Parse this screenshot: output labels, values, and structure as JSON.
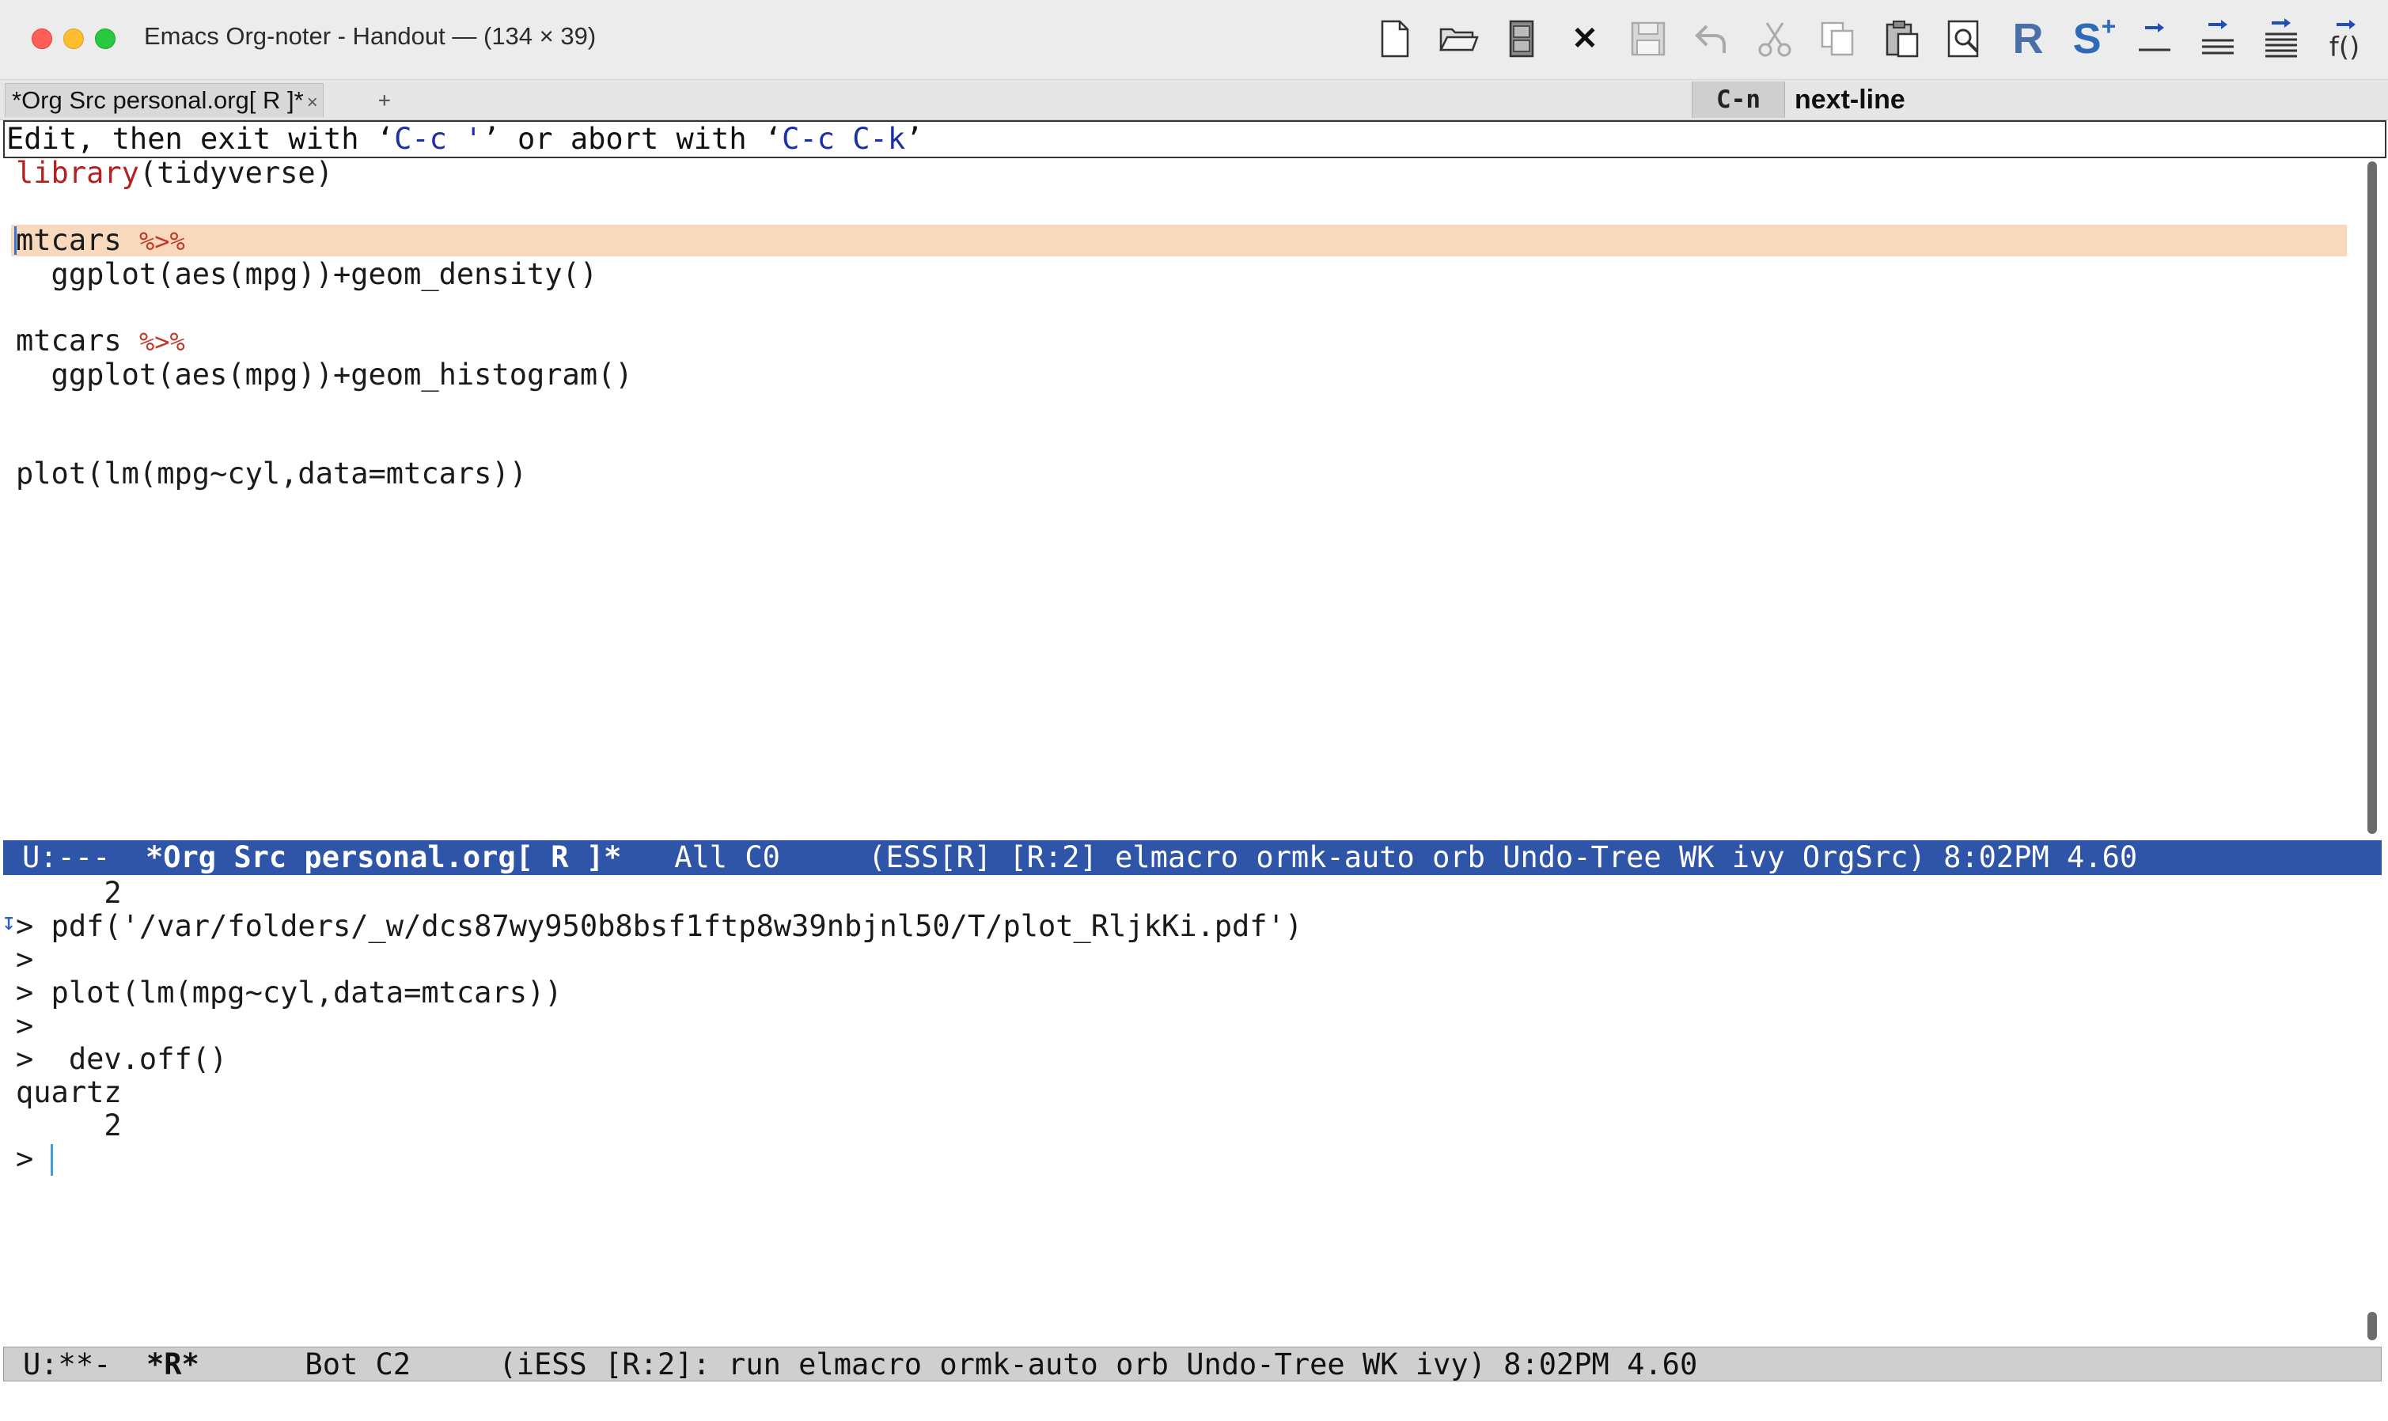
{
  "window": {
    "title": "Emacs Org-noter - Handout — (134 × 39)"
  },
  "toolbar": {
    "icons": [
      "new-file-icon",
      "open-folder-icon",
      "save-cabinet-icon",
      "close-icon",
      "save-disk-icon",
      "undo-icon",
      "cut-icon",
      "copy-icon",
      "paste-icon",
      "search-icon",
      "r-icon",
      "s-plus-icon",
      "eval-line-icon",
      "eval-region-icon",
      "eval-buffer-icon",
      "eval-function-icon"
    ],
    "r_label": "R",
    "s_label": "S",
    "s_plus": "+",
    "f_label": "f()",
    "close_glyph": "✕"
  },
  "tabbar": {
    "tab_label": "*Org Src personal.org[ R ]*",
    "tab_close": "×",
    "new_tab": "+"
  },
  "keyhint": {
    "key": "C-n",
    "command": "next-line"
  },
  "header_line": {
    "p1": "Edit, then exit with ‘",
    "k1": "C-c '",
    "p2": "’ or abort with ‘",
    "k2": "C-c C-k",
    "p3": "’"
  },
  "editor": {
    "l1_fn": "library",
    "l1_rest": "(tidyverse)",
    "l3_obj": "mtcars",
    "l3_op": "%>%",
    "l4": "  ggplot(aes(mpg))+geom_density()",
    "l6_obj": "mtcars",
    "l6_op": "%>%",
    "l7": "  ggplot(aes(mpg))+geom_histogram()",
    "l10": "plot(lm(mpg~cyl,data=mtcars))"
  },
  "modeline_top": {
    "state": "U:---  ",
    "buffer": "*Org Src personal.org[ R ]*",
    "info": "   All C0     (ESS[R] [R:2] elmacro ormk-auto orb Undo-Tree WK ivy OrgSrc) 8:02PM 4.60"
  },
  "repl": {
    "lines": [
      "     2",
      "> pdf('/var/folders/_w/dcs87wy950b8bsf1ftp8w39nbjnl50/T/plot_RljkKi.pdf')",
      ">",
      "> plot(lm(mpg~cyl,data=mtcars))",
      ">",
      ">  dev.off()",
      "quartz",
      "     2",
      "> "
    ]
  },
  "modeline_bottom": {
    "state": "U:**-  ",
    "buffer": "*R*",
    "info": "      Bot C2     (iESS [R:2]: run elmacro ormk-auto orb Undo-Tree WK ivy) 8:02PM 4.60"
  }
}
